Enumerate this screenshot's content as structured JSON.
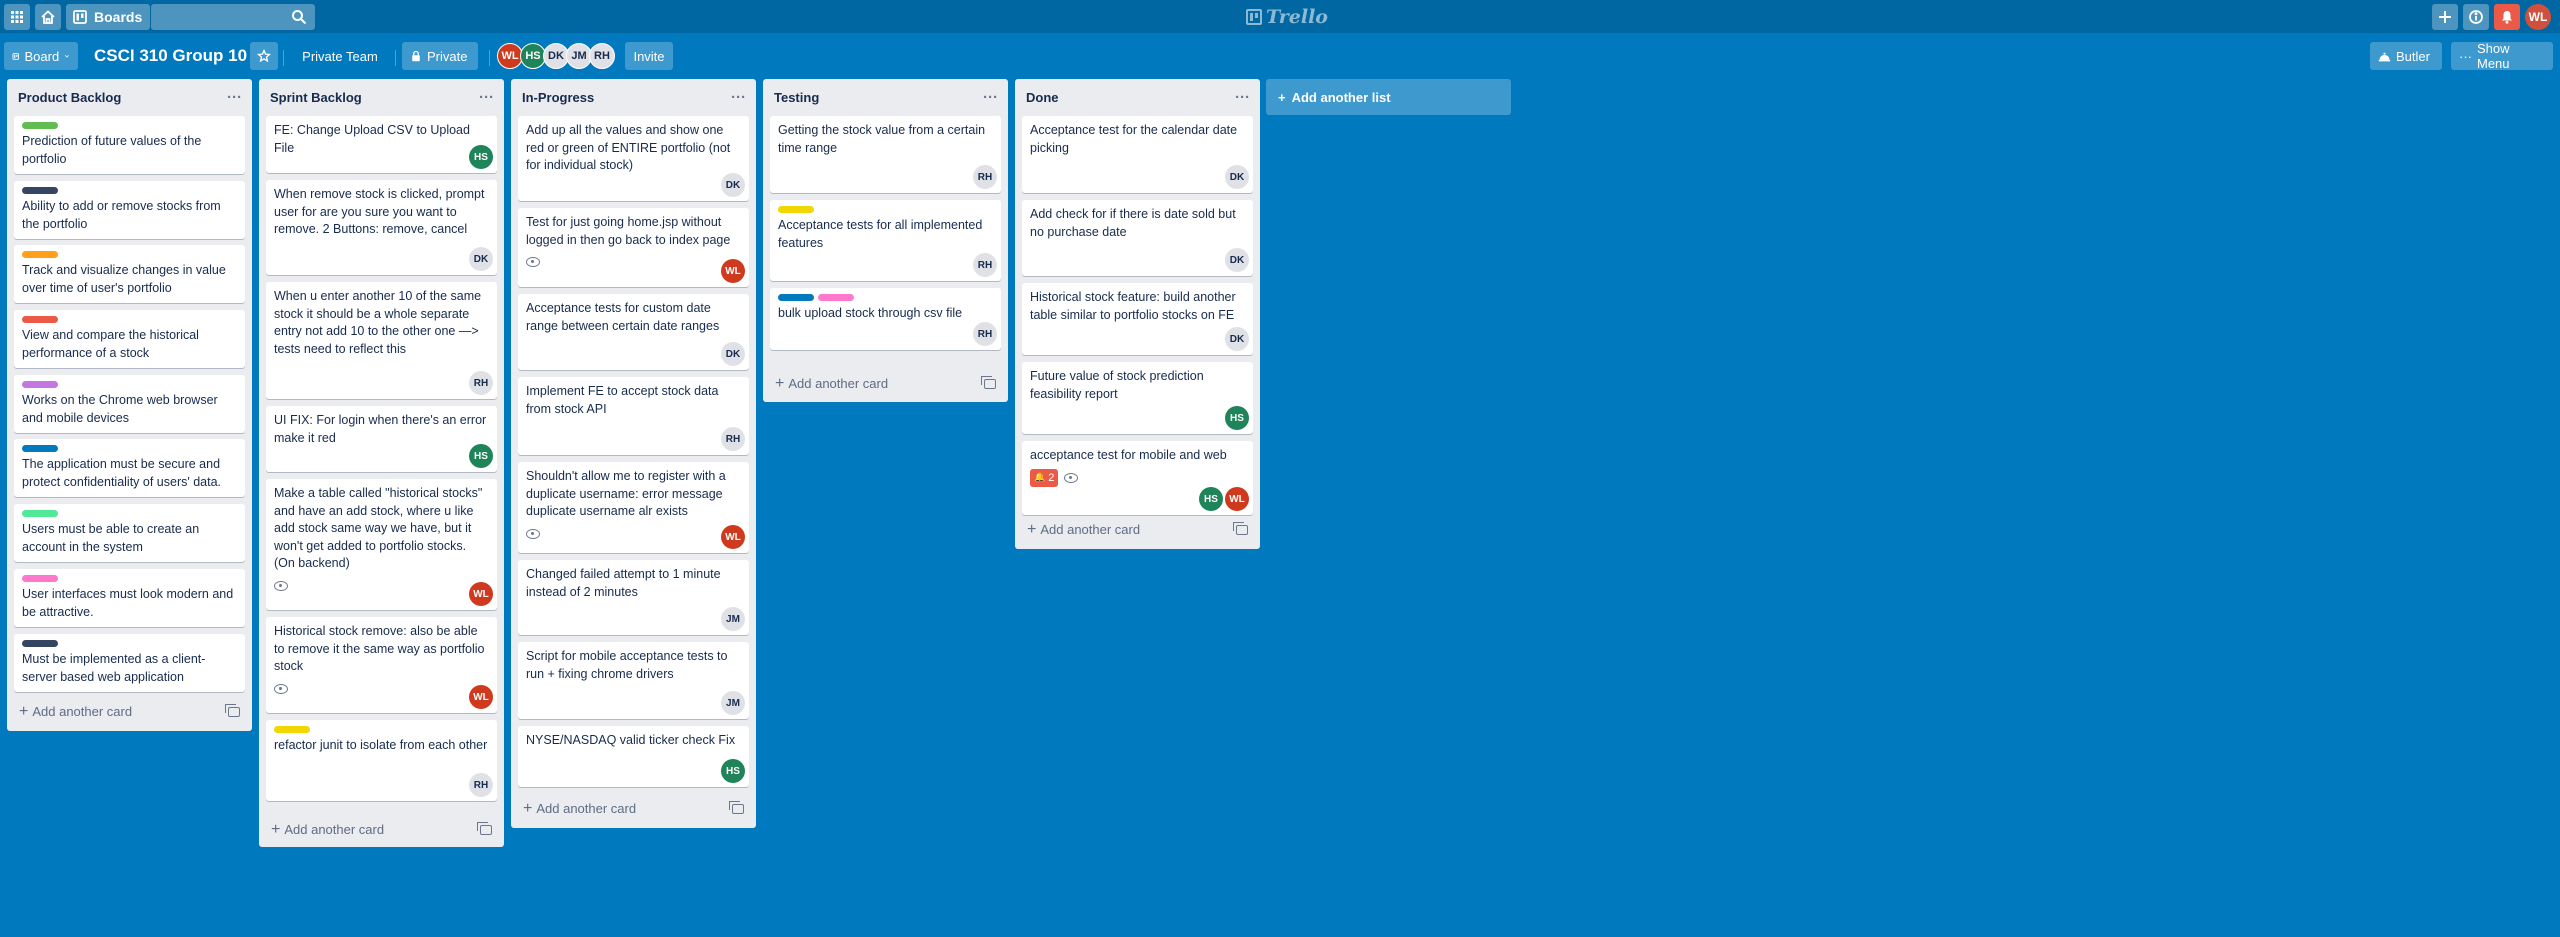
{
  "topbar": {
    "boards_label": "Boards",
    "search_placeholder": "",
    "logo_text": "Trello",
    "user_initials": "WL"
  },
  "board": {
    "view_label": "Board",
    "title": "CSCI 310 Group 10",
    "team_label": "Private Team",
    "visibility_label": "Private",
    "invite_label": "Invite",
    "butler_label": "Butler",
    "show_menu_label": "Show Menu",
    "members": [
      {
        "initials": "WL",
        "bg": "#cf3a1e",
        "fg": "#ffffff"
      },
      {
        "initials": "HS",
        "bg": "#1f845a",
        "fg": "#ffffff"
      },
      {
        "initials": "DK",
        "bg": "#dfe1e6",
        "fg": "#172b4d"
      },
      {
        "initials": "JM",
        "bg": "#dfe1e6",
        "fg": "#172b4d"
      },
      {
        "initials": "RH",
        "bg": "#dfe1e6",
        "fg": "#172b4d"
      }
    ]
  },
  "add_list_label": "Add another list",
  "add_card_label": "Add another card",
  "lists": [
    {
      "title": "Product Backlog",
      "cards": [
        {
          "text": "Prediction of future values of the portfolio"
        },
        {
          "text": "Ability to add or remove stocks from the portfolio"
        },
        {
          "text": "Track and visualize changes in value over time of user's portfolio"
        },
        {
          "text": "View and compare the historical performance of a stock"
        },
        {
          "text": "Works on the Chrome web browser and mobile devices"
        },
        {
          "text": "The application must be secure and protect confidentiality of users' data."
        },
        {
          "text": "Users must be able to create an account in the system"
        },
        {
          "text": "User interfaces must look modern and be attractive."
        },
        {
          "text": "Must be implemented as a client-server based web application"
        }
      ]
    },
    {
      "title": "Sprint Backlog",
      "cards": [
        {
          "text": "FE: Change Upload CSV to Upload File",
          "members": [
            "HS"
          ]
        },
        {
          "text": "When remove stock is clicked, prompt user for are you sure you want to remove. 2 Buttons: remove, cancel",
          "members": [
            "DK"
          ]
        },
        {
          "text": "When u enter another 10 of the same stock it should be a whole separate entry not add 10 to the other one —> tests need to reflect this",
          "members": [
            "RH"
          ]
        },
        {
          "text": "UI FIX: For login when there's an error make it red",
          "members": [
            "HS"
          ]
        },
        {
          "text": "Make a table called \"historical stocks\" and have an add stock, where u like add stock same way we have, but it won't get added to portfolio stocks. (On backend)",
          "members": [
            "WL"
          ]
        },
        {
          "text": "Historical stock remove: also be able to remove it the same way as portfolio stock",
          "members": [
            "WL"
          ]
        },
        {
          "text": "refactor junit to isolate from each other",
          "members": [
            "RH"
          ]
        }
      ]
    },
    {
      "title": "In-Progress",
      "cards": [
        {
          "text": "Add up all the values and show one red or green of ENTIRE portfolio (not for individual stock)",
          "members": [
            "DK"
          ]
        },
        {
          "text": "Test for just going home.jsp without logged in then go back to index page",
          "members": [
            "WL"
          ]
        },
        {
          "text": "Acceptance tests for custom date range between certain date ranges",
          "members": [
            "DK"
          ]
        },
        {
          "text": "Implement FE to accept stock data from stock API",
          "members": [
            "RH"
          ]
        },
        {
          "text": "Shouldn't allow me to register with a duplicate username: error message duplicate username alr exists",
          "members": [
            "WL"
          ]
        },
        {
          "text": "Changed failed attempt to 1 minute instead of 2 minutes",
          "members": [
            "JM"
          ]
        },
        {
          "text": "Script for mobile acceptance tests to run + fixing chrome drivers",
          "members": [
            "JM"
          ]
        },
        {
          "text": "NYSE/NASDAQ valid ticker check Fix",
          "members": [
            "HS"
          ]
        }
      ]
    },
    {
      "title": "Testing",
      "cards": [
        {
          "text": "Getting the stock value from a certain time range",
          "members": [
            "RH"
          ]
        },
        {
          "text": "Acceptance tests for all implemented features",
          "members": [
            "RH"
          ]
        },
        {
          "text": "bulk upload stock through csv file",
          "members": [
            "RH"
          ]
        }
      ]
    },
    {
      "title": "Done",
      "cards": [
        {
          "text": "Acceptance test for the calendar date picking",
          "members": [
            "DK"
          ]
        },
        {
          "text": "Add check for if there is date sold but no purchase date",
          "members": [
            "DK"
          ]
        },
        {
          "text": "Historical stock feature: build another table similar to portfolio stocks on FE",
          "members": [
            "DK"
          ]
        },
        {
          "text": "Future value of stock prediction feasibility report",
          "members": [
            "HS"
          ]
        },
        {
          "text": "acceptance test for mobile and web",
          "due_count": "2",
          "members": [
            "HS",
            "WL"
          ]
        }
      ]
    }
  ],
  "label_colors": {
    "green": "#61bd4f",
    "navy": "#344563",
    "orange": "#ff9f1a",
    "red": "#eb5a46",
    "purple": "#c377e0",
    "blue": "#0079bf",
    "lime": "#51e898",
    "pink": "#ff78cb",
    "yellow": "#f2d600"
  }
}
